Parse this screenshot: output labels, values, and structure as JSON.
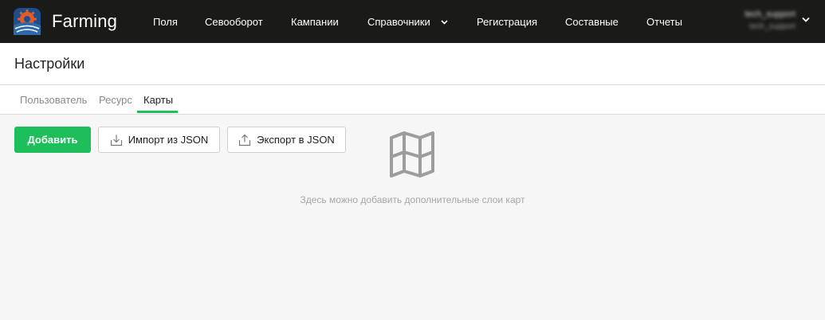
{
  "app": {
    "brand": "Farming",
    "colors": {
      "topbar": "#1a1a18",
      "accent": "#1dbf5b",
      "logo_bg": "#1e4f8c",
      "logo_gear": "#e05a2a"
    }
  },
  "nav": {
    "items": [
      {
        "label": "Поля"
      },
      {
        "label": "Севооборот"
      },
      {
        "label": "Кампании"
      },
      {
        "label": "Справочники",
        "has_dropdown": true
      },
      {
        "label": "Регистрация"
      },
      {
        "label": "Составные"
      },
      {
        "label": "Отчеты"
      }
    ],
    "user": {
      "name": "tech_support",
      "sub": "tech_support",
      "icon": "chevron-down-icon"
    }
  },
  "page": {
    "title": "Настройки",
    "tabs": [
      {
        "label": "Пользователь",
        "active": false
      },
      {
        "label": "Ресурс",
        "active": false
      },
      {
        "label": "Карты",
        "active": true
      }
    ]
  },
  "toolbar": {
    "add_label": "Добавить",
    "import_label": "Импорт из JSON",
    "import_icon": "download-icon",
    "export_label": "Экспорт в JSON",
    "export_icon": "upload-icon"
  },
  "empty_state": {
    "icon": "map-icon",
    "text": "Здесь можно добавить дополнительные слои карт"
  }
}
